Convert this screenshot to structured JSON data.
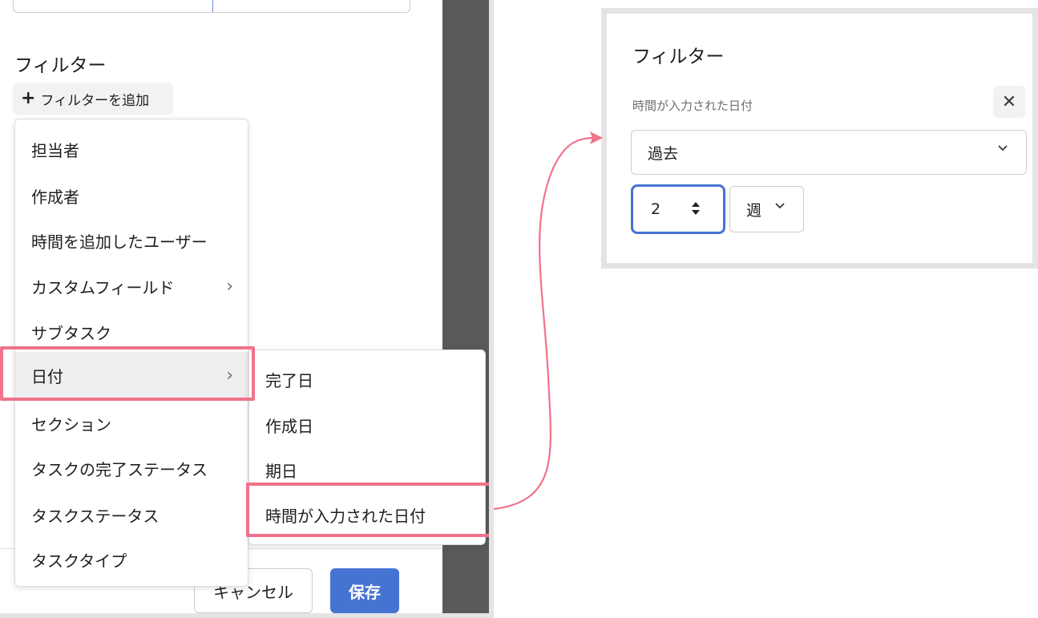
{
  "filter_panel": {
    "heading": "フィルター",
    "add_filter_label": "フィルターを追加",
    "add_filter_icon": "plus-icon"
  },
  "filter_menu": {
    "items": [
      {
        "label": "担当者",
        "has_submenu": false
      },
      {
        "label": "作成者",
        "has_submenu": false
      },
      {
        "label": "時間を追加したユーザー",
        "has_submenu": false
      },
      {
        "label": "カスタムフィールド",
        "has_submenu": true
      },
      {
        "label": "サブタスク",
        "has_submenu": false
      },
      {
        "label": "日付",
        "has_submenu": true,
        "highlighted": true
      },
      {
        "label": "セクション",
        "has_submenu": false
      },
      {
        "label": "タスクの完了ステータス",
        "has_submenu": false
      },
      {
        "label": "タスクステータス",
        "has_submenu": false
      },
      {
        "label": "タスクタイプ",
        "has_submenu": false
      }
    ],
    "submenu_chevron": "›"
  },
  "date_submenu": {
    "items": [
      {
        "label": "完了日"
      },
      {
        "label": "作成日"
      },
      {
        "label": "期日"
      },
      {
        "label": "時間が入力された日付",
        "highlighted": true
      }
    ]
  },
  "footer": {
    "cancel_label": "キャンセル",
    "save_label": "保存"
  },
  "filter_detail": {
    "title": "フィルター",
    "field_label": "時間が入力された日付",
    "close_glyph": "✕",
    "period_select": "過去",
    "count_value": "2",
    "unit_select": "週"
  },
  "colors": {
    "highlight": "#f1728a",
    "primary": "#4573d2",
    "overlay": "#58595b"
  }
}
